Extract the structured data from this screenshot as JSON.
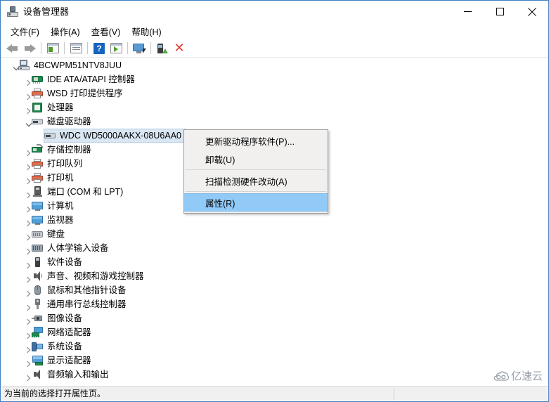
{
  "window": {
    "title": "设备管理器",
    "icon": "device-manager-icon",
    "controls": {
      "minimize": "—",
      "maximize": "□",
      "close": "✕"
    }
  },
  "menubar": {
    "items": [
      {
        "label": "文件(F)",
        "name": "menu-file"
      },
      {
        "label": "操作(A)",
        "name": "menu-action"
      },
      {
        "label": "查看(V)",
        "name": "menu-view"
      },
      {
        "label": "帮助(H)",
        "name": "menu-help"
      }
    ]
  },
  "toolbar": {
    "buttons": [
      {
        "name": "back-arrow-icon",
        "kind": "back"
      },
      {
        "name": "forward-arrow-icon",
        "kind": "fwd"
      },
      {
        "name": "separator-1",
        "kind": "sep"
      },
      {
        "name": "show-hide-console-tree-icon",
        "kind": "tree"
      },
      {
        "name": "properties-icon",
        "kind": "props"
      },
      {
        "name": "separator-2",
        "kind": "sep"
      },
      {
        "name": "help-icon",
        "kind": "help",
        "glyph": "?"
      },
      {
        "name": "scan-hardware-changes-icon",
        "kind": "scan"
      },
      {
        "name": "separator-3",
        "kind": "sep"
      },
      {
        "name": "update-driver-icon",
        "kind": "monitor"
      },
      {
        "name": "separator-4",
        "kind": "sep"
      },
      {
        "name": "enable-device-icon",
        "kind": "device"
      },
      {
        "name": "uninstall-device-icon",
        "kind": "xmark",
        "glyph": "✕"
      }
    ]
  },
  "tree": {
    "root": {
      "label": "4BCWPM51NTV8JUU",
      "icon": "computer-icon",
      "expanded": true,
      "indent": 0
    },
    "nodes": [
      {
        "label": "IDE ATA/ATAPI 控制器",
        "icon": "ide-controller-icon",
        "iconClass": "ti-ide",
        "indent": 1,
        "expander": "collapsed",
        "selected": false
      },
      {
        "label": "WSD 打印提供程序",
        "icon": "printer-icon",
        "iconClass": "ti-printer",
        "indent": 1,
        "expander": "collapsed",
        "selected": false
      },
      {
        "label": "处理器",
        "icon": "cpu-icon",
        "iconClass": "ti-cpu",
        "indent": 1,
        "expander": "collapsed",
        "selected": false
      },
      {
        "label": "磁盘驱动器",
        "icon": "disk-drive-icon",
        "iconClass": "ti-disk",
        "indent": 1,
        "expander": "expanded",
        "selected": false
      },
      {
        "label": "WDC WD5000AAKX-08U6AA0",
        "icon": "disk-drive-icon",
        "iconClass": "ti-disk",
        "indent": 2,
        "expander": "none",
        "selected": true
      },
      {
        "label": "存储控制器",
        "icon": "storage-controller-icon",
        "iconClass": "ti-storage",
        "indent": 1,
        "expander": "collapsed",
        "selected": false
      },
      {
        "label": "打印队列",
        "icon": "printer-icon",
        "iconClass": "ti-printer",
        "indent": 1,
        "expander": "collapsed",
        "selected": false
      },
      {
        "label": "打印机",
        "icon": "printer-icon",
        "iconClass": "ti-printer",
        "indent": 1,
        "expander": "collapsed",
        "selected": false
      },
      {
        "label": "端口 (COM 和 LPT)",
        "icon": "port-icon",
        "iconClass": "ti-port",
        "indent": 1,
        "expander": "collapsed",
        "selected": false
      },
      {
        "label": "计算机",
        "icon": "monitor-icon",
        "iconClass": "ti-monitor",
        "indent": 1,
        "expander": "collapsed",
        "selected": false
      },
      {
        "label": "监视器",
        "icon": "monitor-icon",
        "iconClass": "ti-monitor",
        "indent": 1,
        "expander": "collapsed",
        "selected": false
      },
      {
        "label": "键盘",
        "icon": "keyboard-icon",
        "iconClass": "ti-keyboard",
        "indent": 1,
        "expander": "collapsed",
        "selected": false
      },
      {
        "label": "人体学输入设备",
        "icon": "hid-icon",
        "iconClass": "ti-hid",
        "indent": 1,
        "expander": "collapsed",
        "selected": false
      },
      {
        "label": "软件设备",
        "icon": "software-device-icon",
        "iconClass": "ti-soft",
        "indent": 1,
        "expander": "collapsed",
        "selected": false
      },
      {
        "label": "声音、视频和游戏控制器",
        "icon": "sound-icon",
        "iconClass": "ti-sound",
        "indent": 1,
        "expander": "collapsed",
        "selected": false
      },
      {
        "label": "鼠标和其他指针设备",
        "icon": "mouse-icon",
        "iconClass": "ti-mouse",
        "indent": 1,
        "expander": "collapsed",
        "selected": false
      },
      {
        "label": "通用串行总线控制器",
        "icon": "usb-icon",
        "iconClass": "ti-usb",
        "indent": 1,
        "expander": "collapsed",
        "selected": false
      },
      {
        "label": "图像设备",
        "icon": "imaging-device-icon",
        "iconClass": "ti-imaging",
        "indent": 1,
        "expander": "collapsed",
        "selected": false
      },
      {
        "label": "网络适配器",
        "icon": "network-adapter-icon",
        "iconClass": "ti-net",
        "indent": 1,
        "expander": "collapsed",
        "selected": false
      },
      {
        "label": "系统设备",
        "icon": "system-device-icon",
        "iconClass": "ti-sys",
        "indent": 1,
        "expander": "collapsed",
        "selected": false
      },
      {
        "label": "显示适配器",
        "icon": "display-adapter-icon",
        "iconClass": "ti-display",
        "indent": 1,
        "expander": "collapsed",
        "selected": false
      },
      {
        "label": "音频输入和输出",
        "icon": "audio-io-icon",
        "iconClass": "ti-audio",
        "indent": 1,
        "expander": "collapsed",
        "selected": false
      }
    ]
  },
  "context_menu": {
    "items": [
      {
        "label": "更新驱动程序软件(P)...",
        "name": "ctx-update-driver",
        "highlighted": false,
        "separator_after": false
      },
      {
        "label": "卸载(U)",
        "name": "ctx-uninstall",
        "highlighted": false,
        "separator_after": true
      },
      {
        "label": "扫描检测硬件改动(A)",
        "name": "ctx-scan-hardware",
        "highlighted": false,
        "separator_after": true
      },
      {
        "label": "属性(R)",
        "name": "ctx-properties",
        "highlighted": true,
        "separator_after": false
      }
    ]
  },
  "statusbar": {
    "message": "为当前的选择打开属性页。"
  },
  "watermark": {
    "text": "亿速云",
    "icon": "cloud-icon"
  },
  "colors": {
    "accent": "#3f7fbf",
    "menu_highlight": "#91c9f7",
    "tree_selection": "#d9e6f3",
    "help_blue": "#1565c0",
    "close_red": "#e23b30"
  }
}
